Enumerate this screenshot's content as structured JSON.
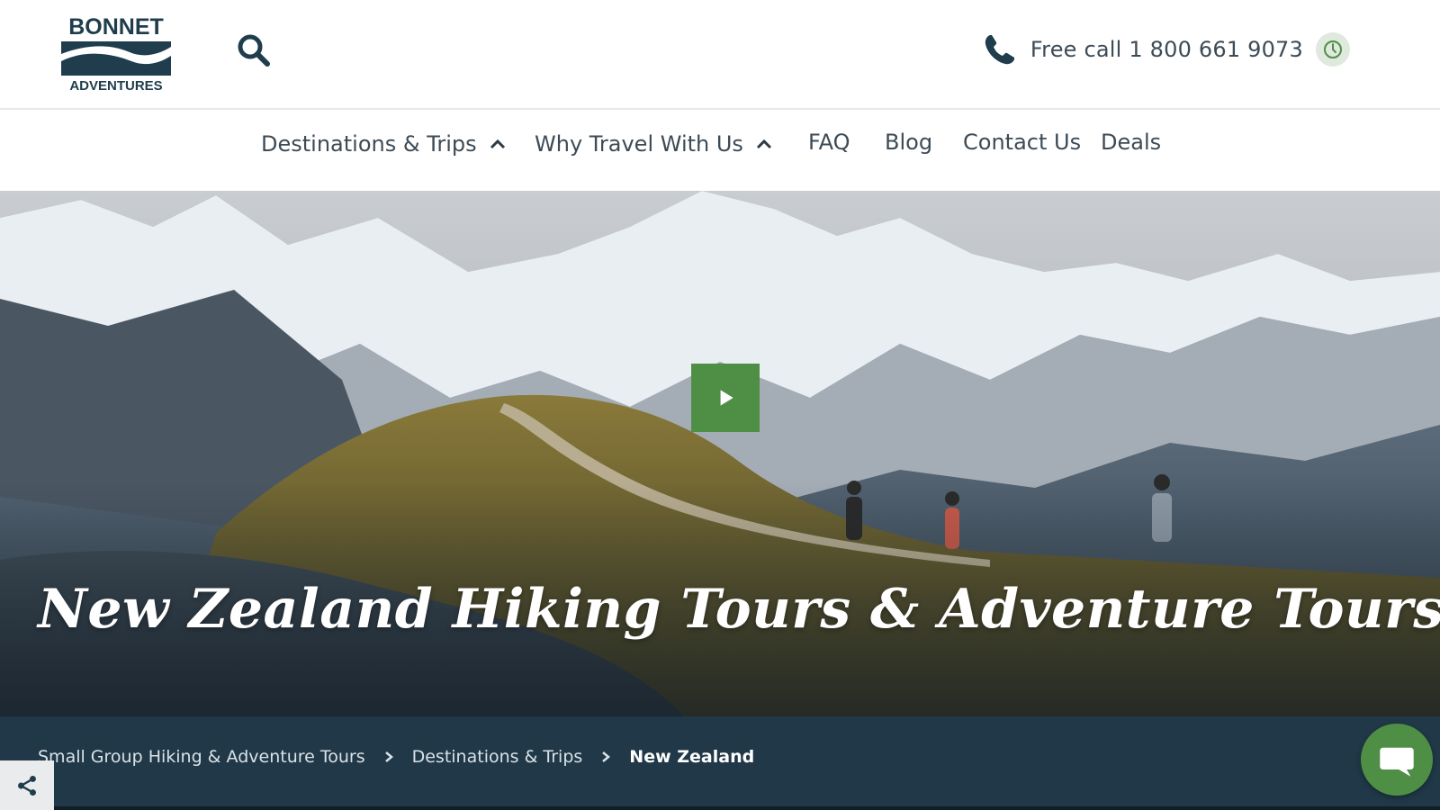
{
  "brand": {
    "line1": "BONNET",
    "line2": "ADVENTURES"
  },
  "header": {
    "search_icon": "search-icon",
    "phone_icon": "phone-icon",
    "call_text": "Free call 1 800 661 9073",
    "clock_icon": "clock-icon"
  },
  "nav": {
    "items": [
      {
        "label": "Destinations & Trips",
        "has_dropdown": true
      },
      {
        "label": "Why Travel With Us",
        "has_dropdown": true
      },
      {
        "label": "FAQ"
      },
      {
        "label": "Blog"
      },
      {
        "label": "Contact Us"
      },
      {
        "label": "Deals"
      }
    ]
  },
  "hero": {
    "title": "New Zealand Hiking Tours & Adventure Tours",
    "play_icon": "play-icon"
  },
  "breadcrumb": {
    "items": [
      "Small Group Hiking & Adventure Tours",
      "Destinations & Trips",
      "New Zealand"
    ]
  },
  "widgets": {
    "share_icon": "share-icon",
    "chat_icon": "chat-icon"
  },
  "colors": {
    "brand_navy": "#1f3d4c",
    "accent_green": "#4f8f45",
    "breadcrumb_bg": "#203847"
  }
}
